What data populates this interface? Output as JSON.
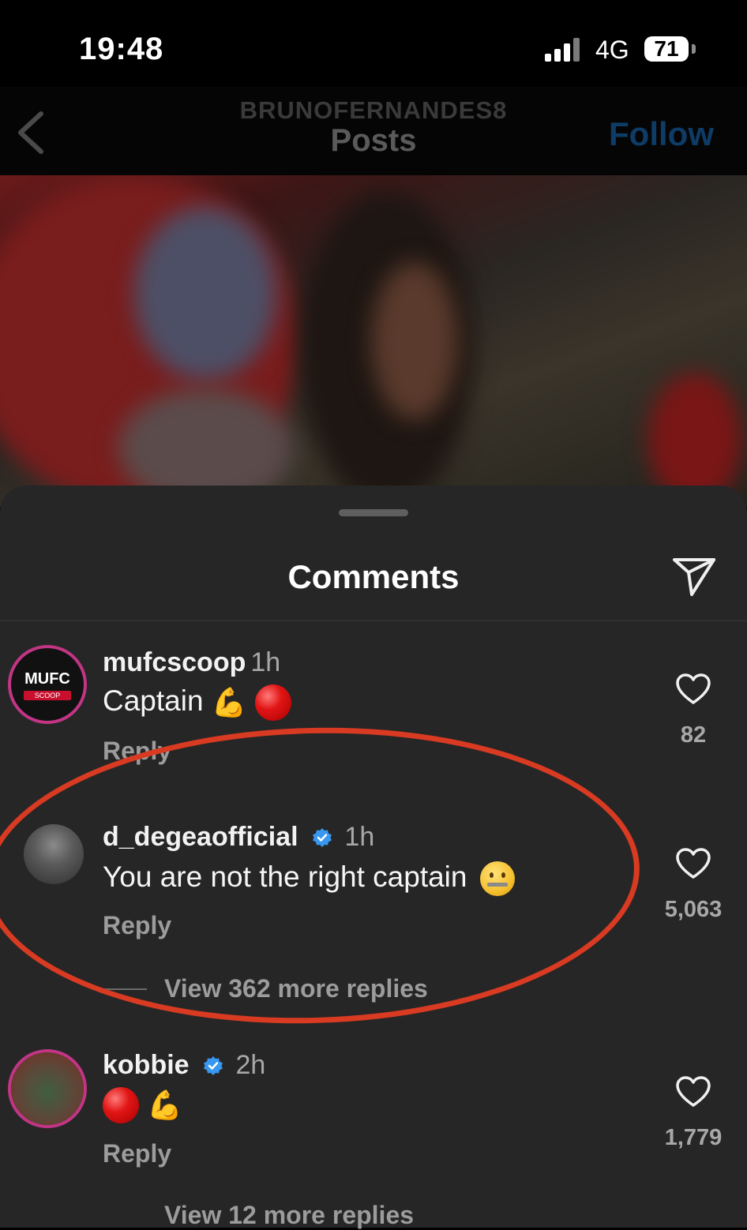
{
  "status_bar": {
    "time": "19:48",
    "network": "4G",
    "battery": "71"
  },
  "header": {
    "username": "BRUNOFERNANDES8",
    "title": "Posts",
    "follow_label": "Follow"
  },
  "sheet": {
    "title": "Comments"
  },
  "comments": [
    {
      "username": "mufcscoop",
      "time": "1h",
      "verified": false,
      "text": "Captain",
      "emoji": [
        "flexed-biceps",
        "red-circle"
      ],
      "reply_label": "Reply",
      "likes": "82",
      "avatar_text": "MUFC",
      "avatar_subtext": "SCOOP"
    },
    {
      "username": "d_degeaofficial",
      "time": "1h",
      "verified": true,
      "text": "You are not the right captain",
      "emoji": [
        "zipper-mouth-face"
      ],
      "reply_label": "Reply",
      "likes": "5,063",
      "view_replies": "View 362 more replies"
    },
    {
      "username": "kobbie",
      "time": "2h",
      "verified": true,
      "text": "",
      "emoji": [
        "red-circle",
        "flexed-biceps"
      ],
      "reply_label": "Reply",
      "likes": "1,779",
      "view_replies": "View 12 more replies"
    }
  ],
  "colors": {
    "highlight_circle": "#d83a22",
    "follow_button": "#0e3c66",
    "verified_badge": "#3897f0",
    "sheet_background": "#262626"
  }
}
